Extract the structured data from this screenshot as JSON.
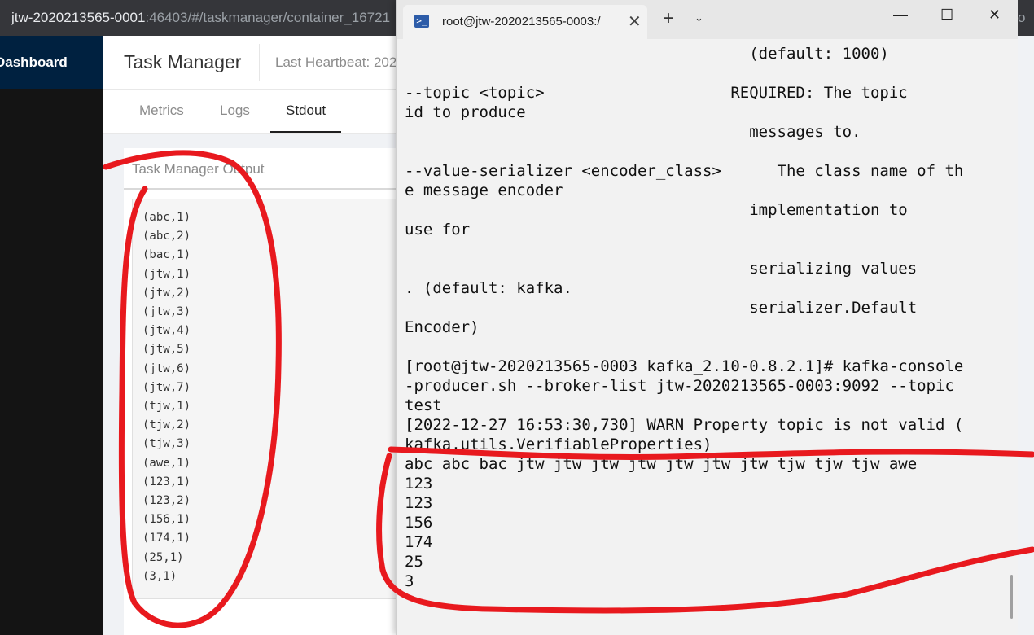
{
  "browser": {
    "host": "jtw-2020213565-0001",
    "url_rest": ":46403/#/taskmanager/container_16721",
    "url_tail": "o"
  },
  "dashboard": {
    "brand": "Dashboard",
    "title": "Task Manager",
    "heartbeat_label": "Last Heartbeat: 202",
    "tabs": [
      "Metrics",
      "Logs",
      "Stdout"
    ],
    "active_tab": "Stdout",
    "output_title": "Task Manager Output",
    "stdout_lines": [
      "(abc,1)",
      "(abc,2)",
      "(bac,1)",
      "(jtw,1)",
      "(jtw,2)",
      "(jtw,3)",
      "(jtw,4)",
      "(jtw,5)",
      "(jtw,6)",
      "(jtw,7)",
      "(tjw,1)",
      "(tjw,2)",
      "(tjw,3)",
      "(awe,1)",
      "(123,1)",
      "(123,2)",
      "(156,1)",
      "(174,1)",
      "(25,1)",
      "(3,1)"
    ]
  },
  "terminal": {
    "tab_title": "root@jtw-2020213565-0003:/",
    "tab_icon": ">_",
    "new_tab": "+",
    "dropdown": "⌄",
    "minimize": "—",
    "maximize": "☐",
    "close": "✕",
    "tab_close": "✕",
    "lines": [
      "                                     (default: 1000)",
      "",
      "--topic <topic>                    REQUIRED: The topic",
      "id to produce",
      "                                     messages to.",
      "",
      "--value-serializer <encoder_class>      The class name of th",
      "e message encoder",
      "                                     implementation to",
      "use for",
      "",
      "                                     serializing values",
      ". (default: kafka.",
      "                                     serializer.Default",
      "Encoder)",
      "",
      "[root@jtw-2020213565-0003 kafka_2.10-0.8.2.1]# kafka-console",
      "-producer.sh --broker-list jtw-2020213565-0003:9092 --topic",
      "test",
      "[2022-12-27 16:53:30,730] WARN Property topic is not valid (",
      "kafka.utils.VerifiableProperties)",
      "abc abc bac jtw jtw jtw jtw jtw jtw jtw tjw tjw tjw awe",
      "123",
      "123",
      "156",
      "174",
      "25",
      "3"
    ]
  },
  "colors": {
    "annotation": "#e8191e",
    "sidebar": "#001529",
    "terminal_bg": "#f2f2f2"
  }
}
